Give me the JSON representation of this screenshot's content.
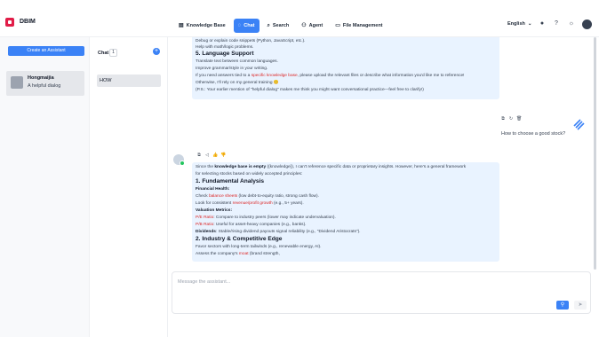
{
  "app": {
    "name": "DBIM"
  },
  "nav": [
    {
      "label": "Knowledge Base",
      "icon": "book-icon",
      "active": false
    },
    {
      "label": "Chat",
      "icon": "chat-icon",
      "active": true
    },
    {
      "label": "Search",
      "icon": "search-icon",
      "active": false
    },
    {
      "label": "Agent",
      "icon": "agent-icon",
      "active": false
    },
    {
      "label": "File Management",
      "icon": "folder-icon",
      "active": false
    }
  ],
  "header": {
    "language": "English"
  },
  "sidebar": {
    "create_label": "Create an Assistant",
    "assistant": {
      "name": "Hongmaijia",
      "description": "A helpful dialog"
    }
  },
  "chats": {
    "title": "Chat",
    "count": "1",
    "items": [
      {
        "label": "HOW"
      }
    ]
  },
  "messages": {
    "first": {
      "lines": [
        "Debug or explain code snippets (Python, JavaScript, etc.).",
        "Help with math/logic problems.",
        "5. Language Support",
        "Translate text between common languages.",
        "Improve grammar/style in your writing.",
        "If you need answers tied to a",
        "specific knowledge base",
        ", please upload the relevant files or describe what information you'd like me to reference!",
        "Otherwise, I'll rely on my general training 😊",
        "(P.S.: Your earlier mention of \"helpful dialog\" makes me think you might want conversational practice—feel free to clarify!)"
      ]
    },
    "user_question": "How to choose a good stock?",
    "second": {
      "intro_a": "Since the ",
      "intro_bold": "knowledge base is empty",
      "intro_b": " ({knowledge}), I can't reference specific data or proprietary insights. However, here's a general framework",
      "intro_c": "for selecting stocks based on widely accepted principles:",
      "h1": "1. Fundamental Analysis",
      "financial_health": "Financial Health:",
      "check_a": "Check ",
      "check_red": "balance sheets",
      "check_b": " (low debt-to-equity ratio, strong cash flow).",
      "look_a": "Look for consistent ",
      "look_red": "revenue/profit growth",
      "look_b": " (e.g., 5+ years).",
      "valuation": "Valuation Metrics:",
      "pe_red": "P/E Ratio",
      "pe_rest": ": Compare to industry peers (lower may indicate undervaluation).",
      "pb_red": "P/B Ratio",
      "pb_rest": ": Useful for asset-heavy companies (e.g., banks).",
      "div_bold": "Dividends",
      "div_rest": ": Stable/rising dividend payouts signal reliability (e.g., \"Dividend Aristocrats\").",
      "h2": "2. Industry & Competitive Edge",
      "favor": "Favor sectors with long-term tailwinds (e.g., renewable energy, AI).",
      "assess_a": "Assess the company's ",
      "assess_red": "moat",
      "assess_b": " (brand strength,"
    }
  },
  "composer": {
    "placeholder": "Message the assistant..."
  }
}
